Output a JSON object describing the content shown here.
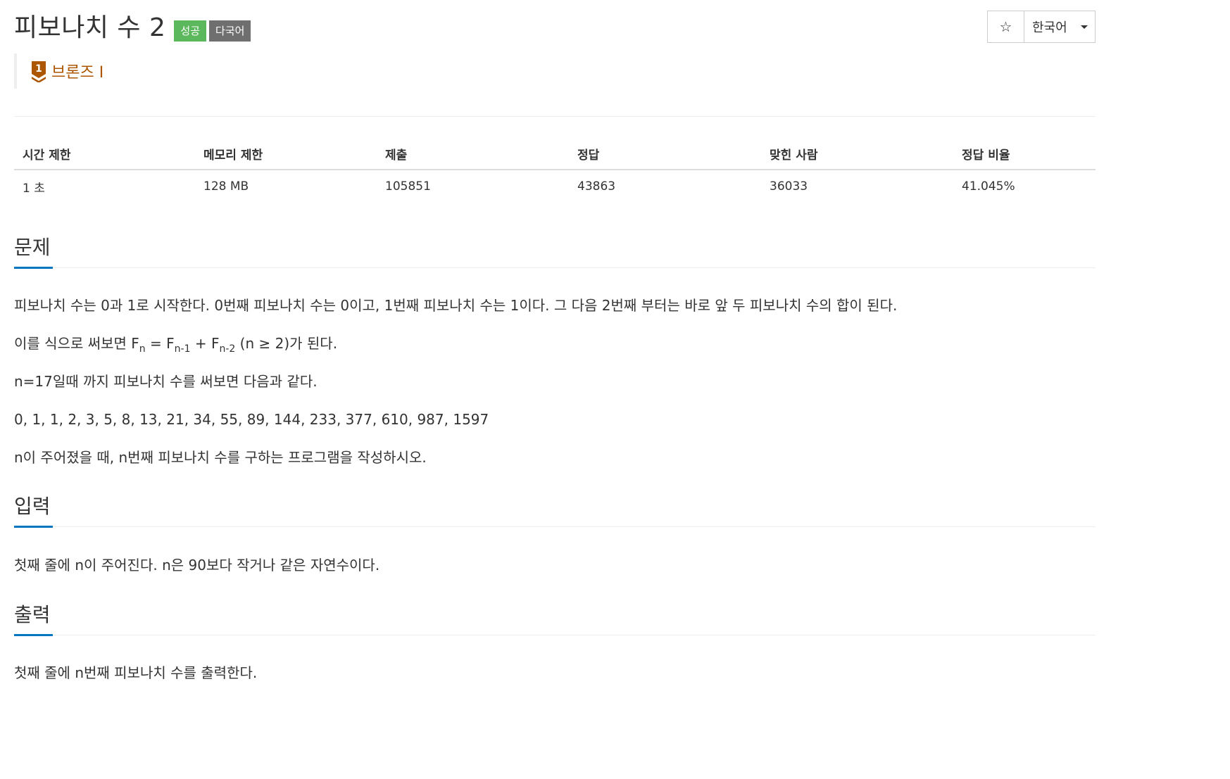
{
  "problem": {
    "title": "피보나치 수 2",
    "labels": {
      "status": "성공",
      "multilang": "다국어"
    },
    "tier": {
      "name": "브론즈 I",
      "level": "1",
      "color": "#ad5600"
    }
  },
  "toolbar": {
    "star_icon": "star-outline-icon",
    "language": "한국어"
  },
  "info": {
    "headers": [
      "시간 제한",
      "메모리 제한",
      "제출",
      "정답",
      "맞힌 사람",
      "정답 비율"
    ],
    "values": [
      "1 초",
      "128 MB",
      "105851",
      "43863",
      "36033",
      "41.045%"
    ]
  },
  "description": {
    "heading": "문제",
    "p1": "피보나치 수는 0과 1로 시작한다. 0번째 피보나치 수는 0이고, 1번째 피보나치 수는 1이다. 그 다음 2번째 부터는 바로 앞 두 피보나치 수의 합이 된다.",
    "p2": {
      "prefix": "이를 식으로 써보면 F",
      "sub1": "n",
      "mid1": " = F",
      "sub2": "n-1",
      "mid2": " + F",
      "sub3": "n-2",
      "suffix": " (n ≥ 2)가 된다."
    },
    "p3": "n=17일때 까지 피보나치 수를 써보면 다음과 같다.",
    "p4": "0, 1, 1, 2, 3, 5, 8, 13, 21, 34, 55, 89, 144, 233, 377, 610, 987, 1597",
    "p5": "n이 주어졌을 때, n번째 피보나치 수를 구하는 프로그램을 작성하시오."
  },
  "input": {
    "heading": "입력",
    "text": "첫째 줄에 n이 주어진다. n은 90보다 작거나 같은 자연수이다."
  },
  "output": {
    "heading": "출력",
    "text": "첫째 줄에 n번째 피보나치 수를 출력한다."
  },
  "colors": {
    "success": "#5cb85c",
    "multilang": "#6f6f6f",
    "section_accent": "#0076c0",
    "bronze": "#ad5600"
  }
}
